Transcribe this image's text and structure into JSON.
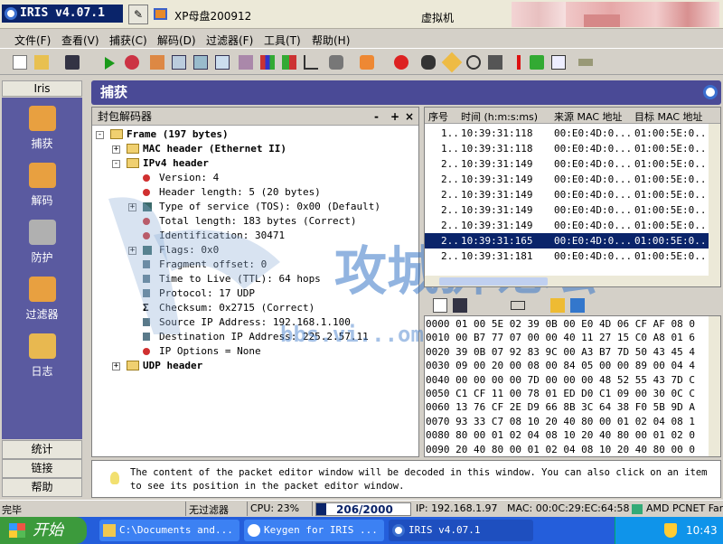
{
  "titlebar": {
    "app_title": "IRIS v4.07.1",
    "adapter": "XP母盘200912",
    "vm_label": "虚拟机"
  },
  "menu": [
    "文件(F)",
    "查看(V)",
    "捕获(C)",
    "解码(D)",
    "过滤器(F)",
    "工具(T)",
    "帮助(H)"
  ],
  "nav": {
    "header": "Iris",
    "items": [
      "捕获",
      "解码",
      "防护",
      "过滤器",
      "日志"
    ],
    "bottom": [
      "统计",
      "链接",
      "帮助"
    ]
  },
  "panel": {
    "title": "捕获"
  },
  "decoder": {
    "title": "封包解码器",
    "controls": [
      "-",
      "+",
      "×"
    ],
    "tree": [
      {
        "text": "Frame (197 bytes)",
        "level": 0,
        "kind": "folder",
        "exp": "-",
        "bold": true
      },
      {
        "text": "MAC header (Ethernet II)",
        "level": 1,
        "kind": "folder",
        "exp": "+",
        "bold": true
      },
      {
        "text": "IPv4 header",
        "level": 1,
        "kind": "folder",
        "exp": "-",
        "bold": true
      },
      {
        "text": "Version: 4",
        "level": 2,
        "kind": "dot"
      },
      {
        "text": "Header length: 5 (20 bytes)",
        "level": 2,
        "kind": "dot"
      },
      {
        "text": "Type of service (TOS): 0x00 (Default)",
        "level": 2,
        "kind": "sq",
        "exp": "+"
      },
      {
        "text": "Total length: 183 bytes (Correct)",
        "level": 2,
        "kind": "dot"
      },
      {
        "text": "Identification: 30471",
        "level": 2,
        "kind": "dot"
      },
      {
        "text": "Flags: 0x0",
        "level": 2,
        "kind": "sq",
        "exp": "+"
      },
      {
        "text": "Fragment offset: 0",
        "level": 2,
        "kind": "sq2"
      },
      {
        "text": "Time to Live (TTL): 64 hops",
        "level": 2,
        "kind": "sq2"
      },
      {
        "text": "Protocol: 17  UDP",
        "level": 2,
        "kind": "sq2"
      },
      {
        "text": "Checksum: 0x2715 (Correct)",
        "level": 2,
        "kind": "sigma"
      },
      {
        "text": "Source IP Address: 192.168.1.100",
        "level": 2,
        "kind": "sq2"
      },
      {
        "text": "Destination IP Address: 225.2.57.11",
        "level": 2,
        "kind": "sq2"
      },
      {
        "text": "IP Options = None",
        "level": 2,
        "kind": "dot"
      },
      {
        "text": "UDP header",
        "level": 1,
        "kind": "folder",
        "exp": "+",
        "bold": true
      }
    ]
  },
  "watermark": {
    "title": "攻城狮论坛",
    "url": "bbs.vi...om"
  },
  "packets": {
    "columns": [
      "序号",
      "时间 (h:m:s:ms)",
      "来源 MAC 地址",
      "目标 MAC 地址"
    ],
    "rows": [
      [
        "1..",
        "10:39:31:118",
        "00:E0:4D:0...",
        "01:00:5E:0..."
      ],
      [
        "1..",
        "10:39:31:118",
        "00:E0:4D:0...",
        "01:00:5E:0..."
      ],
      [
        "2..",
        "10:39:31:149",
        "00:E0:4D:0...",
        "01:00:5E:0..."
      ],
      [
        "2..",
        "10:39:31:149",
        "00:E0:4D:0...",
        "01:00:5E:0..."
      ],
      [
        "2..",
        "10:39:31:149",
        "00:E0:4D:0...",
        "01:00:5E:0..."
      ],
      [
        "2..",
        "10:39:31:149",
        "00:E0:4D:0...",
        "01:00:5E:0..."
      ],
      [
        "2..",
        "10:39:31:149",
        "00:E0:4D:0...",
        "01:00:5E:0..."
      ],
      [
        "2..",
        "10:39:31:165",
        "00:E0:4D:0...",
        "01:00:5E:0..."
      ],
      [
        "2..",
        "10:39:31:181",
        "00:E0:4D:0...",
        "01:00:5E:0..."
      ]
    ],
    "selected": 7
  },
  "hex": [
    "0000 01 00 5E 02 39 0B 00 E0 4D 06 CF AF 08 0",
    "0010 00 B7 77 07 00 00 40 11 27 15 C0 A8 01 6",
    "0020 39 0B 07 92 83 9C 00 A3 B7 7D 50 43 45 4",
    "0030 09 00 20 00 08 00 84 05 00 00 89 00 04 4",
    "0040 00 00 00 00 7D 00 00 00 48 52 55 43 7D C",
    "0050 C1 CF 11 00 78 01 ED D0 C1 09 00 30 0C C",
    "0060 13 76 CF 2E D9 66 8B 3C 64 38 F0 5B 9D A",
    "0070 93 33 C7 08 10 20 40 80 00 01 02 04 08 1",
    "0080 80 00 01 02 04 08 10 20 40 80 00 01 02 0",
    "0090 20 40 80 00 01 02 04 08 10 20 40 80 00 0"
  ],
  "info": "The content of the packet editor window will be decoded in this window. You can also click on an item to see its position in the packet editor window.",
  "status": {
    "ready": "完毕",
    "filter": "无过滤器",
    "cpu": "CPU: 23%",
    "buffer": "206/2000",
    "buffer_fill": 0.103,
    "ip": "IP: 192.168.1.97",
    "mac": "MAC: 00:0C:29:EC:64:58",
    "nic": "AMD PCNET Fami"
  },
  "taskbar": {
    "start": "开始",
    "tasks": [
      "C:\\Documents and...",
      "Keygen for IRIS ...",
      "IRIS v4.07.1"
    ],
    "clock": "10:43"
  }
}
